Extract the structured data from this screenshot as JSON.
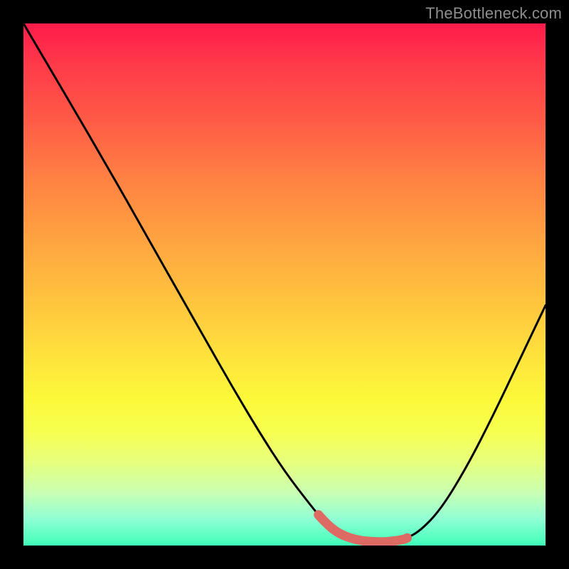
{
  "watermark": "TheBottleneck.com",
  "frame": {
    "outer": 800,
    "inset": 33,
    "inner": 734
  },
  "colors": {
    "background": "#000000",
    "curve": "#000000",
    "highlight": "#dd6a63",
    "watermark": "#8e8e8e"
  },
  "chart_data": {
    "type": "line",
    "title": "",
    "xlabel": "",
    "ylabel": "",
    "xlim": [
      0,
      1
    ],
    "ylim": [
      0,
      1
    ],
    "grid": false,
    "legend": false,
    "series": [
      {
        "name": "bottleneck-curve",
        "x_note": "normalized 0..1 across plot width; y is normalized 0=top, 1=bottom of plot",
        "x": [
          0.0,
          0.05,
          0.1,
          0.15,
          0.2,
          0.25,
          0.3,
          0.35,
          0.4,
          0.45,
          0.5,
          0.55,
          0.57,
          0.59,
          0.61,
          0.64,
          0.67,
          0.7,
          0.73,
          0.76,
          0.8,
          0.85,
          0.9,
          0.95,
          1.0
        ],
        "y": [
          0.0,
          0.085,
          0.17,
          0.256,
          0.343,
          0.432,
          0.52,
          0.608,
          0.696,
          0.78,
          0.858,
          0.923,
          0.947,
          0.967,
          0.98,
          0.99,
          0.993,
          0.993,
          0.988,
          0.972,
          0.93,
          0.848,
          0.75,
          0.645,
          0.54
        ]
      }
    ],
    "highlight_segment": {
      "description": "thick colored arc at curve minimum",
      "x_start": 0.565,
      "x_end": 0.735
    }
  }
}
